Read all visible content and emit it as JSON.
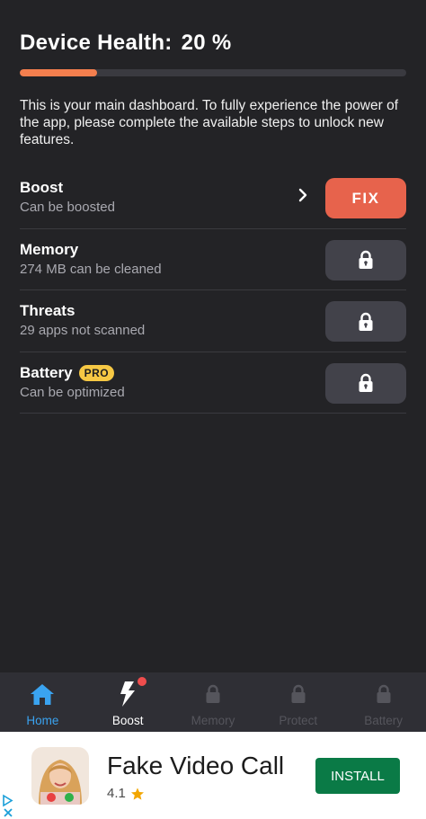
{
  "header": {
    "title": "Device Health:",
    "percent": "20 %",
    "progress_fraction": 0.2,
    "progress_color": "#f47f4e"
  },
  "intro": "This is your main dashboard. To fully experience the power of the app, please complete the available steps to unlock new features.",
  "rows": [
    {
      "name": "Boost",
      "sub": "Can be boosted",
      "action": "FIX",
      "icon": "chevron-right-icon"
    },
    {
      "name": "Memory",
      "sub": "274 MB can be cleaned",
      "icon": "lock-icon"
    },
    {
      "name": "Threats",
      "sub": "29 apps not scanned",
      "icon": "lock-icon"
    },
    {
      "name": "Battery",
      "badge": "PRO",
      "sub": "Can be optimized",
      "icon": "lock-icon"
    }
  ],
  "nav": [
    {
      "label": "Home",
      "icon": "home-icon",
      "color": "#3aa3f0"
    },
    {
      "label": "Boost",
      "icon": "lightning-icon",
      "color": "#ffffff"
    },
    {
      "label": "Memory",
      "icon": "lock-icon",
      "color": "#55555c"
    },
    {
      "label": "Protect",
      "icon": "lock-icon",
      "color": "#55555c"
    },
    {
      "label": "Battery",
      "icon": "lock-icon",
      "color": "#55555c"
    }
  ],
  "ad": {
    "title": "Fake Video Call",
    "rating": "4.1",
    "install_label": "INSTALL",
    "install_color": "#0a7a46"
  }
}
